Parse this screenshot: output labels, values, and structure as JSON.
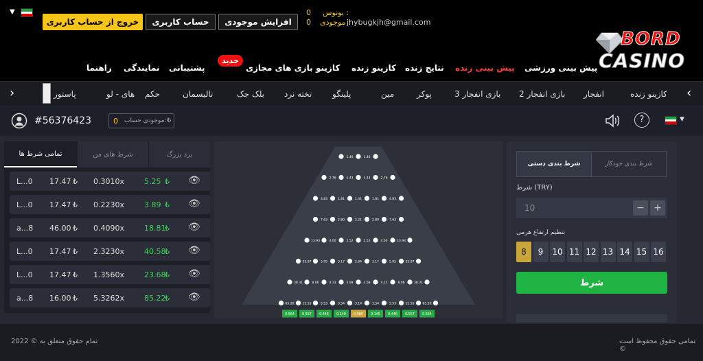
{
  "header": {
    "logout_label": "خروج از حساب کاربری",
    "account_label": "حساب کاربری",
    "deposit_label": "افزایش موجودی",
    "bonus_label": "بونوس :",
    "bonus_value": "0",
    "balance_label": "موجودی :",
    "balance_value": "0",
    "email": "jhybugkjh@gmail.com",
    "logo_top": "BORD",
    "logo_bottom": "CASINO"
  },
  "nav": {
    "items": [
      "راهنما",
      "نمایندگی",
      "پشتیبانی",
      "بازی های مجازی",
      "کازینو",
      "کازینو زنده",
      "نتایج زنده",
      "پیش بینی زنده",
      "پیش بینی ورزشی"
    ],
    "new_badge": "جدید"
  },
  "categories": {
    "items": [
      "پاستور",
      "های - لو",
      "حکم",
      "تالیسمان",
      "بلک جک",
      "تخته نرد",
      "پلینگو",
      "مین",
      "پوکر",
      "بازی انفجار 3",
      "بازی انفجار 2",
      "انفجار",
      "کازینو زنده"
    ]
  },
  "infobar": {
    "user_id": "#56376423",
    "account_balance_label": "موجودی حساب:",
    "account_balance_value": "0"
  },
  "left_panel": {
    "tabs": [
      "تمامی شرط ها",
      "شرط های من",
      "برد بزرگ"
    ],
    "rows": [
      {
        "user": "L...0",
        "bet": "17.47",
        "mult": "0.3010x",
        "win": "5.25"
      },
      {
        "user": "L...0",
        "bet": "17.47",
        "mult": "0.2230x",
        "win": "3.89"
      },
      {
        "user": "a...8",
        "bet": "46.00",
        "mult": "0.4090x",
        "win": "18.81"
      },
      {
        "user": "L...0",
        "bet": "17.47",
        "mult": "2.3230x",
        "win": "40.58"
      },
      {
        "user": "L...0",
        "bet": "17.47",
        "mult": "1.3560x",
        "win": "23.68"
      },
      {
        "user": "a...8",
        "bet": "16.00",
        "mult": "5.3262x",
        "win": "85.22"
      }
    ],
    "currency": "₺"
  },
  "board": {
    "rows": [
      [
        "1.40",
        "1.40"
      ],
      [
        "2.76",
        "1.43",
        "1.43",
        "2.76"
      ],
      [
        "4.83",
        "1.81",
        "1.41",
        "1.81",
        "4.83"
      ],
      [
        "7.63",
        "2.80",
        "2.21",
        "2.80",
        "7.63"
      ],
      [
        "13.93",
        "4.00",
        "2.52",
        "2.52",
        "4.00",
        "13.93"
      ],
      [
        "23.87",
        "5.95",
        "3.17",
        "2.64",
        "3.17",
        "5.95",
        "23.87"
      ],
      [
        "38.31",
        "8.06",
        "4.13",
        "3.08",
        "3.08",
        "4.13",
        "8.06",
        "38.31"
      ],
      [
        "65.20",
        "11.55",
        "5.53",
        "3.54",
        "3.14",
        "3.54",
        "5.53",
        "11.55",
        "65.20"
      ]
    ],
    "slots": [
      "0.564",
      "0.557",
      "0.446",
      "0.149",
      "0.086",
      "0.145",
      "0.446",
      "0.557",
      "0.564"
    ]
  },
  "right_panel": {
    "tab_manual": "شرط بندی دستی",
    "tab_auto": "شرط بندی خودکار",
    "bet_label": "شرط (TRY)",
    "bet_value": "10",
    "minus": "−",
    "plus": "+",
    "pyramid_label": "تنظیم ارتفاع هرمی",
    "levels": [
      "16",
      "15",
      "14",
      "13",
      "12",
      "11",
      "10",
      "9",
      "8"
    ],
    "selected_level": "8",
    "bet_button": "شرط"
  },
  "footer": {
    "left": "تمام حقوق متعلق به © 2022",
    "right": "تمامی حقوق محفوظ است ©"
  }
}
